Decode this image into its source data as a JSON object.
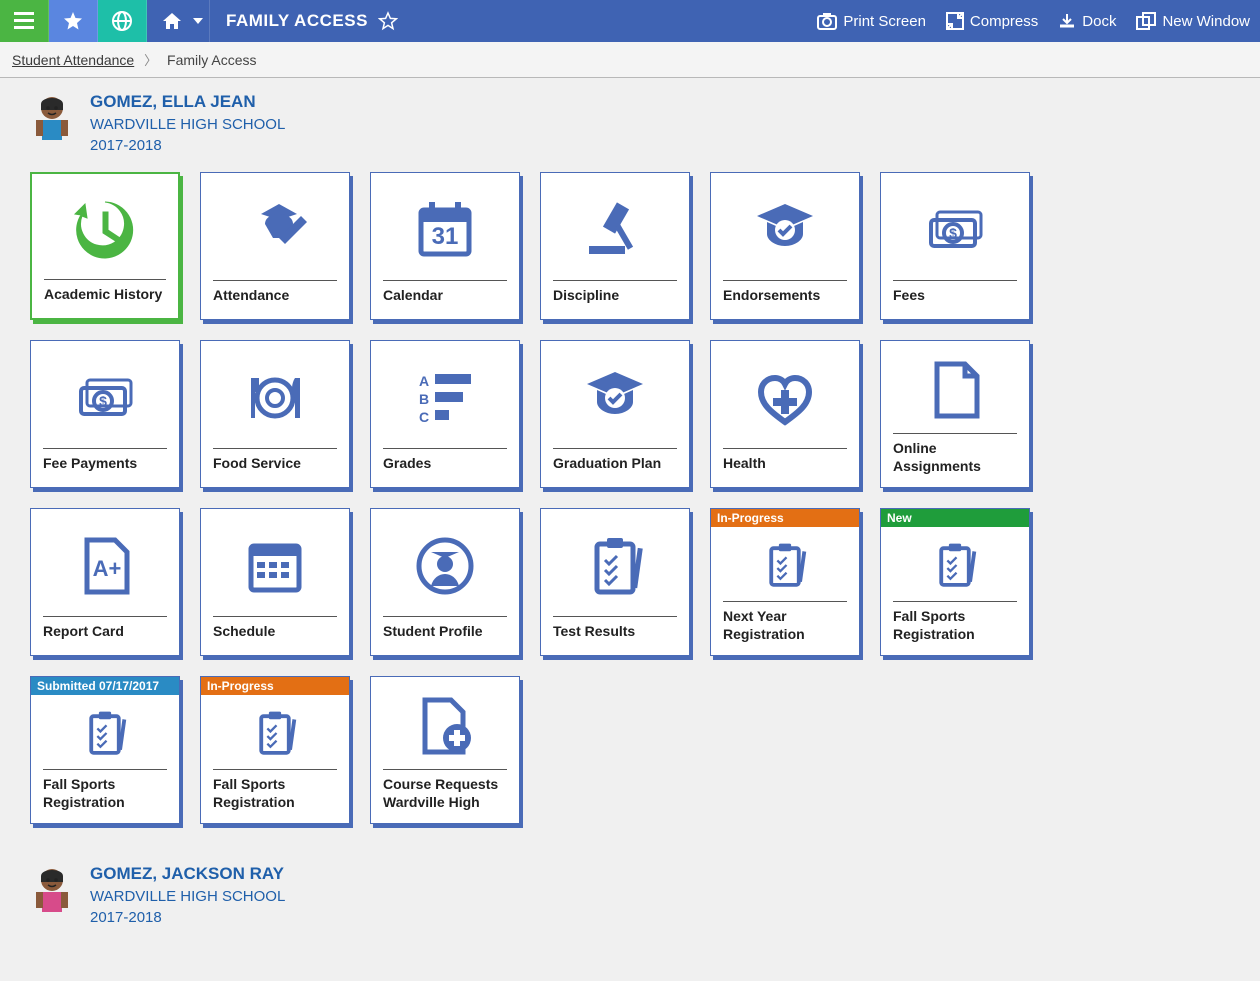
{
  "topbar": {
    "title": "FAMILY ACCESS",
    "actions": {
      "print": "Print Screen",
      "compress": "Compress",
      "dock": "Dock",
      "newWindow": "New Window"
    }
  },
  "breadcrumb": {
    "parent": "Student Attendance",
    "current": "Family Access"
  },
  "students": [
    {
      "name": "GOMEZ, ELLA JEAN",
      "school": "WARDVILLE HIGH SCHOOL",
      "year": "2017-2018",
      "tiles": [
        {
          "label": "Academic History",
          "icon": "history",
          "selected": true
        },
        {
          "label": "Attendance",
          "icon": "attendance"
        },
        {
          "label": "Calendar",
          "icon": "calendar"
        },
        {
          "label": "Discipline",
          "icon": "gavel"
        },
        {
          "label": "Endorsements",
          "icon": "gradcheck"
        },
        {
          "label": "Fees",
          "icon": "money"
        },
        {
          "label": "Fee Payments",
          "icon": "money"
        },
        {
          "label": "Food Service",
          "icon": "food"
        },
        {
          "label": "Grades",
          "icon": "grades"
        },
        {
          "label": "Graduation Plan",
          "icon": "gradcheck"
        },
        {
          "label": "Health",
          "icon": "health"
        },
        {
          "label": "Online Assignments",
          "icon": "doc"
        },
        {
          "label": "Report Card",
          "icon": "report"
        },
        {
          "label": "Schedule",
          "icon": "schedule"
        },
        {
          "label": "Student Profile",
          "icon": "profile"
        },
        {
          "label": "Test Results",
          "icon": "clipboard"
        },
        {
          "label": "Next Year Registration",
          "icon": "clipboard",
          "status": {
            "text": "In-Progress",
            "color": "orange"
          }
        },
        {
          "label": "Fall Sports Registration",
          "icon": "clipboard",
          "status": {
            "text": "New",
            "color": "green"
          }
        },
        {
          "label": "Fall Sports Registration",
          "icon": "clipboard",
          "status": {
            "text": "Submitted 07/17/2017",
            "color": "blue"
          }
        },
        {
          "label": "Fall Sports Registration",
          "icon": "clipboard",
          "status": {
            "text": "In-Progress",
            "color": "orange"
          }
        },
        {
          "label": "Course Requests Wardville High",
          "icon": "docplus"
        }
      ]
    },
    {
      "name": "GOMEZ, JACKSON RAY",
      "school": "WARDVILLE HIGH SCHOOL",
      "year": "2017-2018",
      "tiles": []
    }
  ],
  "colors": {
    "brandBlue": "#4a6bb7",
    "topbar": "#3f63b3",
    "green": "#4bb543",
    "teal": "#1ebfa8",
    "orange": "#e36f14",
    "statusGreen": "#1f9d3b",
    "statusBlue": "#2a8bc4",
    "link": "#1f5faa"
  }
}
